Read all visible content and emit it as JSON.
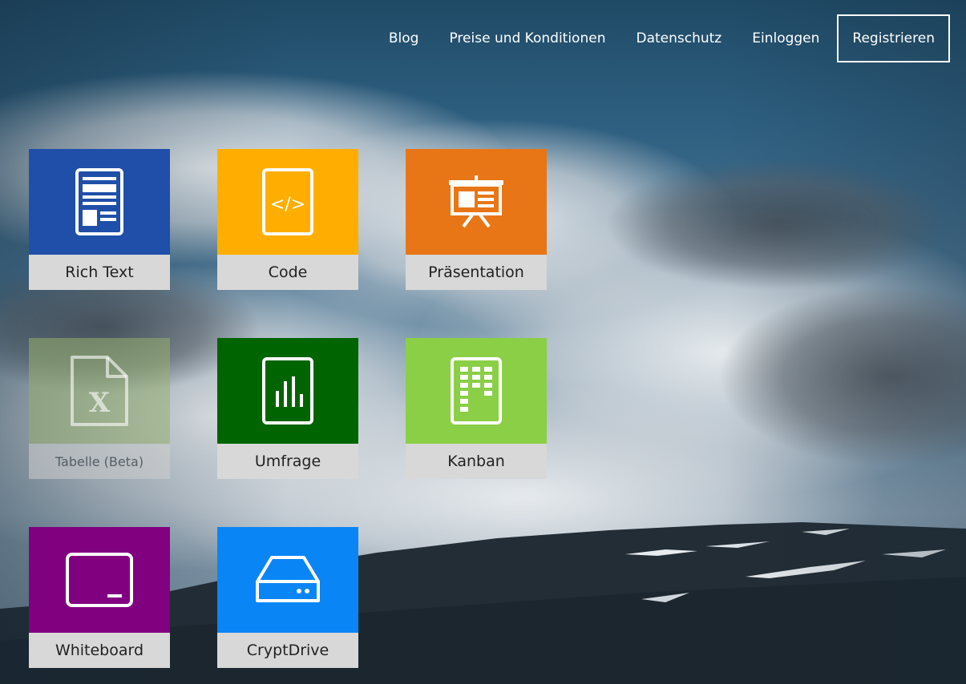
{
  "nav": {
    "links": [
      "Blog",
      "Preise und Konditionen",
      "Datenschutz",
      "Einloggen"
    ],
    "register": "Registrieren"
  },
  "apps": [
    {
      "label": "Rich Text",
      "color": "#1f4fa8",
      "icon": "document-icon",
      "enabled": true
    },
    {
      "label": "Code",
      "color": "#ffae00",
      "icon": "code-icon",
      "enabled": true
    },
    {
      "label": "Präsentation",
      "color": "#e87616",
      "icon": "presentation-icon",
      "enabled": true
    },
    {
      "label": "Tabelle (Beta)",
      "color": "#8aa36a",
      "icon": "spreadsheet-icon",
      "enabled": false
    },
    {
      "label": "Umfrage",
      "color": "#006400",
      "icon": "poll-chart-icon",
      "enabled": true
    },
    {
      "label": "Kanban",
      "color": "#8bcf46",
      "icon": "kanban-board-icon",
      "enabled": true
    },
    {
      "label": "Whiteboard",
      "color": "#800080",
      "icon": "whiteboard-icon",
      "enabled": true
    },
    {
      "label": "CryptDrive",
      "color": "#0a85f5",
      "icon": "drive-icon",
      "enabled": true
    }
  ]
}
